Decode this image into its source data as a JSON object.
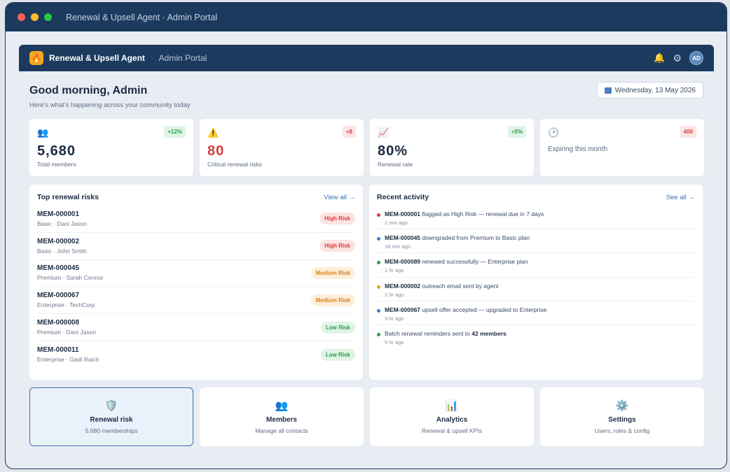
{
  "window": {
    "title": "Renewal & Upsell Agent · Admin Portal"
  },
  "appbar": {
    "brand": "Renewal & Upsell Agent",
    "separator": "·",
    "section": "Admin Portal",
    "avatar_initials": "AD",
    "logo_glyph": "🔥"
  },
  "greeting": {
    "title": "Good morning, Admin",
    "subtitle": "Here's what's happening across your community today"
  },
  "date": "Wednesday, 13 May 2026",
  "kpis": [
    {
      "icon": "members-icon",
      "glyph": "👥",
      "value": "5,680",
      "label": "Total members",
      "delta": "+12%",
      "delta_kind": "pos"
    },
    {
      "icon": "warning-icon",
      "glyph": "⚠️",
      "value": "80",
      "label": "Critical renewal risks",
      "delta": "+8",
      "delta_kind": "neg"
    },
    {
      "icon": "trend-icon",
      "glyph": "📈",
      "value": "80%",
      "label": "Renewal rate",
      "delta": "+5%",
      "delta_kind": "pos"
    },
    {
      "icon": "clock-icon",
      "glyph": "🕑",
      "value": "",
      "label": "Expiring this month",
      "delta": "400",
      "delta_kind": "neg"
    }
  ],
  "risks": {
    "title": "Top renewal risks",
    "link": "View all →",
    "rows": [
      {
        "id": "MEM-000001",
        "meta": "Basic · Dani Jason",
        "badge": "High Risk",
        "level": "high"
      },
      {
        "id": "MEM-000002",
        "meta": "Basic · John Smith",
        "badge": "High Risk",
        "level": "high"
      },
      {
        "id": "MEM-000045",
        "meta": "Premium · Sarah Connor",
        "badge": "Medium Risk",
        "level": "med"
      },
      {
        "id": "MEM-000067",
        "meta": "Enterprise · TechCorp",
        "badge": "Medium Risk",
        "level": "med"
      },
      {
        "id": "MEM-000008",
        "meta": "Premium · Dani Jason",
        "badge": "Low Risk",
        "level": "low"
      },
      {
        "id": "MEM-000011",
        "meta": "Enterprise · Gadi Raich",
        "badge": "Low Risk",
        "level": "low"
      }
    ]
  },
  "activity": {
    "title": "Recent activity",
    "link": "See all →",
    "items": [
      {
        "bold": "MEM-000001",
        "text": " flagged as High Risk — renewal due in 7 days",
        "time": "2 min ago",
        "color": "#d63b3b"
      },
      {
        "bold": "MEM-000045",
        "text": " downgraded from Premium to Basic plan",
        "time": "18 min ago",
        "color": "#3a80c4"
      },
      {
        "bold": "MEM-000089",
        "text": " renewed successfully — Enterprise plan",
        "time": "1 hr ago",
        "color": "#249b4a"
      },
      {
        "bold": "MEM-000002",
        "text": " outreach email sent by agent",
        "time": "2 hr ago",
        "color": "#e6a11f"
      },
      {
        "bold": "MEM-000067",
        "text": " upsell offer accepted — upgraded to Enterprise",
        "time": "3 hr ago",
        "color": "#3a80c4"
      },
      {
        "pre": "Batch renewal reminders sent to ",
        "bold": "42 members",
        "time": "5 hr ago",
        "color": "#249b4a"
      }
    ]
  },
  "tiles": [
    {
      "icon": "shield-icon",
      "glyph": "🛡️",
      "title": "Renewal risk",
      "sub": "5,680 memberships",
      "active": true
    },
    {
      "icon": "members-icon",
      "glyph": "👥",
      "title": "Members",
      "sub": "Manage all contacts",
      "active": false
    },
    {
      "icon": "analytics-icon",
      "glyph": "📊",
      "title": "Analytics",
      "sub": "Renewal & upsell KPIs",
      "active": false
    },
    {
      "icon": "gear-icon",
      "glyph": "⚙️",
      "title": "Settings",
      "sub": "Users, roles & config",
      "active": false
    }
  ]
}
